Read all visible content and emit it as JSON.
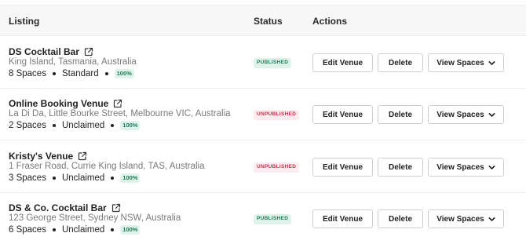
{
  "table": {
    "headers": {
      "listing": "Listing",
      "status": "Status",
      "actions": "Actions"
    },
    "buttons": {
      "edit": "Edit Venue",
      "delete": "Delete",
      "view": "View Spaces"
    },
    "rows": [
      {
        "name": "DS Cocktail Bar",
        "address": "King Island, Tasmania, Australia",
        "spaces": "8 Spaces",
        "claim": "Standard",
        "completion": "100%",
        "status": "PUBLISHED",
        "status_type": "published"
      },
      {
        "name": "Online Booking Venue",
        "address": "La Di Da, Little Bourke Street, Melbourne VIC, Australia",
        "spaces": "2 Spaces",
        "claim": "Unclaimed",
        "completion": "100%",
        "status": "UNPUBLISHED",
        "status_type": "unpublished"
      },
      {
        "name": "Kristy's Venue",
        "address": "1 Fraser Road, Currie King Island, TAS, Australia",
        "spaces": "3 Spaces",
        "claim": "Unclaimed",
        "completion": "100%",
        "status": "UNPUBLISHED",
        "status_type": "unpublished"
      },
      {
        "name": "DS & Co. Cocktail Bar",
        "address": "123 George Street, Sydney NSW, Australia",
        "spaces": "6 Spaces",
        "claim": "Unclaimed",
        "completion": "100%",
        "status": "PUBLISHED",
        "status_type": "published"
      }
    ]
  },
  "colors": {
    "published": "#1e7d5a",
    "unpublished": "#c8324a",
    "header_bg": "#f7f7f8"
  },
  "icons": {
    "external_link": "external-link-icon",
    "chevron": "chevron-down-icon"
  }
}
